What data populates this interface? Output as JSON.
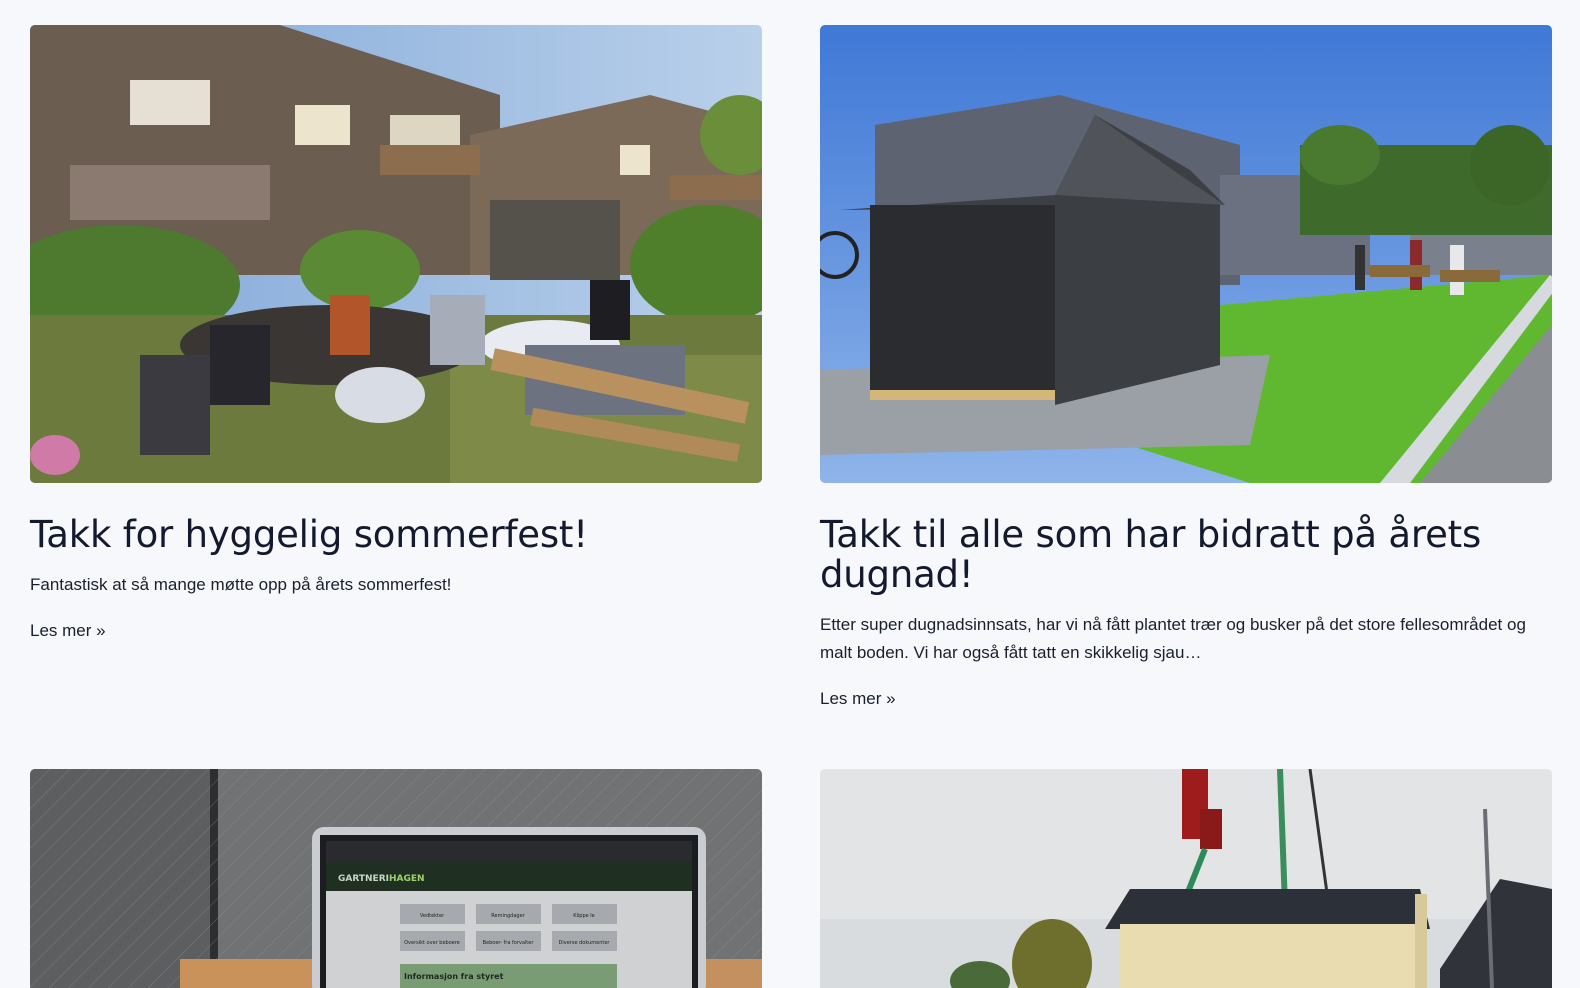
{
  "posts": [
    {
      "title": "Takk for hyggelig sommerfest!",
      "excerpt": "Fantastisk at så mange møtte opp på årets sommerfest!",
      "more": "Les mer »"
    },
    {
      "title": "Takk til alle som har bidratt på årets dugnad!",
      "excerpt": "Etter super dugnadsinnsats, har vi nå fått plantet trær og busker på det store fellesområdet og malt boden. Vi har også fått tatt en skikkelig sjau…",
      "more": "Les mer »"
    }
  ],
  "laptop_screen": {
    "logo_part1": "GARTNERI",
    "logo_part2": "HAGEN",
    "buttons": [
      "Vedtekter",
      "Remingdager",
      "Klippe le",
      "Oversikt over beboere",
      "Beboer- fra forvalter",
      "Diverse dokumenter"
    ],
    "banner": "Informasjon fra styret"
  },
  "colors": {
    "background": "#f7f8fc",
    "text": "#141a2e",
    "grass": "#5fb830",
    "sky": "#4f86d9"
  }
}
